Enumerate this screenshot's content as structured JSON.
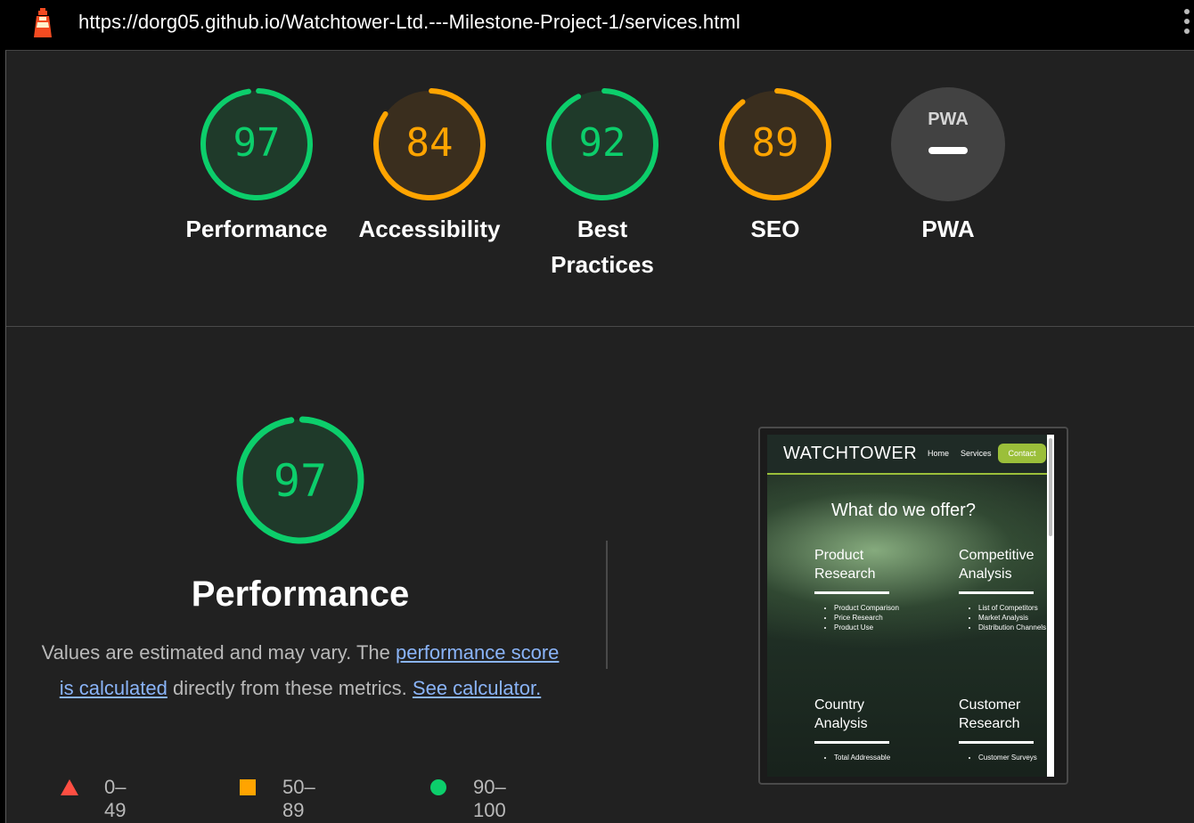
{
  "topbar": {
    "url": "https://dorg05.github.io/Watchtower-Ltd.---Milestone-Project-1/services.html",
    "logo_icon": "lighthouse-icon",
    "more_icon": "more-vertical-icon"
  },
  "gauges": [
    {
      "label": "Performance",
      "score": "97",
      "score_value": 97,
      "color": "#0cce6b",
      "fill": "#1f3a2a"
    },
    {
      "label": "Accessibility",
      "score": "84",
      "score_value": 84,
      "color": "#ffa400",
      "fill": "#3a2e1e"
    },
    {
      "label": "Best",
      "label2": "Practices",
      "score": "92",
      "score_value": 92,
      "color": "#0cce6b",
      "fill": "#1f3a2a"
    },
    {
      "label": "SEO",
      "score": "89",
      "score_value": 89,
      "color": "#ffa400",
      "fill": "#3a2e1e"
    },
    {
      "label": "PWA",
      "badge": "PWA",
      "color": "#6f6f6f",
      "fill": "#424242"
    }
  ],
  "main": {
    "score": "97",
    "score_value": 97,
    "title": "Performance",
    "desc_pre": "Values are estimated and may vary. The ",
    "desc_link1": "performance score is calculated",
    "desc_mid": " directly from these metrics. ",
    "desc_link2": "See calculator."
  },
  "legend": [
    {
      "icon": "triangle-fail-icon",
      "range": "0–49",
      "color": "#ff4e42"
    },
    {
      "icon": "square-average-icon",
      "range": "50–89",
      "color": "#ffa400"
    },
    {
      "icon": "circle-pass-icon",
      "range": "90–100",
      "color": "#0cce6b"
    }
  ],
  "screenshot": {
    "logo": "WATCHTOWER",
    "nav_home": "Home",
    "nav_services": "Services",
    "nav_contact": "Contact",
    "heading": "What do we offer?",
    "services": [
      {
        "title1": "Product",
        "title2": "Research",
        "items": [
          "Product Comparison",
          "Price Research",
          "Product Use"
        ]
      },
      {
        "title1": "Competitive",
        "title2": "Analysis",
        "items": [
          "List of Competitors",
          "Market Analysis",
          "Distribution Channels"
        ]
      },
      {
        "title1": "Country",
        "title2": "Analysis",
        "items": [
          "Total Addressable"
        ]
      },
      {
        "title1": "Customer",
        "title2": "Research",
        "items": [
          "Customer Surveys"
        ]
      }
    ]
  }
}
